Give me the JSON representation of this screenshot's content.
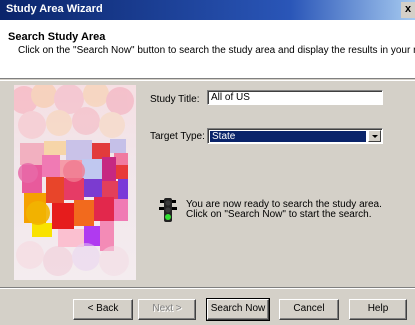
{
  "window": {
    "title": "Study Area Wizard",
    "close_glyph": "x"
  },
  "header": {
    "title": "Search Study Area",
    "description": "Click on the \"Search Now\" button to search the study area and display the results in your repor"
  },
  "form": {
    "study_title_label": "Study Title:",
    "study_title_value": "All of US",
    "target_type_label": "Target Type:",
    "target_type_value": "State"
  },
  "message": {
    "icon": "traffic-light-icon",
    "line1": "You are now ready to search the study area.",
    "line2": "Click on \"Search Now\" to start the search."
  },
  "buttons": {
    "back": "< Back",
    "next": "Next >",
    "search_now": "Search Now",
    "cancel": "Cancel",
    "help": "Help"
  },
  "colors": {
    "titlebar": "#0a246a",
    "dialog_face": "#d4d0c8",
    "selection": "#0a246a"
  }
}
